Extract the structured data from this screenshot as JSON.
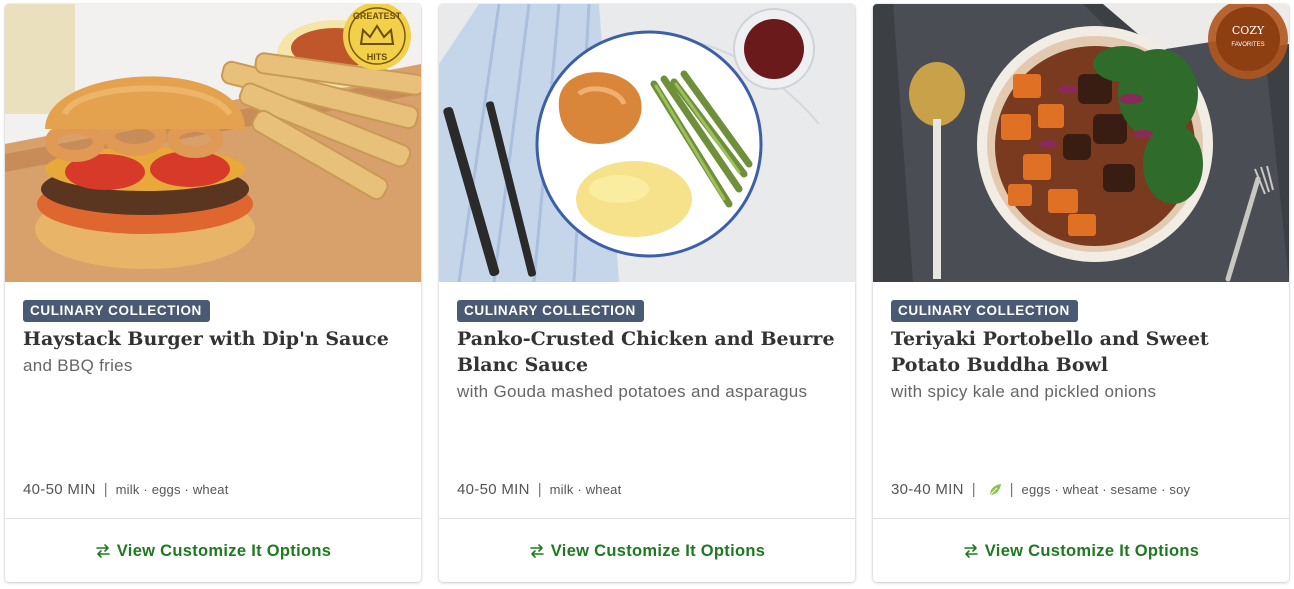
{
  "cards": [
    {
      "badge": "CULINARY COLLECTION",
      "title": "Haystack Burger with Dip'n Sauce",
      "subtitle": "and BBQ fries",
      "time": "40-50 MIN",
      "allergens": "milk · eggs · wheat",
      "seal_line1": "GREATEST",
      "seal_line2": "HITS",
      "customize_label": "View Customize It Options"
    },
    {
      "badge": "CULINARY COLLECTION",
      "title": "Panko-Crusted Chicken and Beurre Blanc Sauce",
      "subtitle": "with Gouda mashed potatoes and asparagus",
      "time": "40-50 MIN",
      "allergens": "milk · wheat",
      "customize_label": "View Customize It Options"
    },
    {
      "badge": "CULINARY COLLECTION",
      "title": "Teriyaki Portobello and Sweet Potato Buddha Bowl",
      "subtitle": "with spicy kale and pickled onions",
      "time": "30-40 MIN",
      "allergens": "eggs · wheat · sesame · soy",
      "seal_line1": "COZY",
      "seal_line2": "FAVORITES",
      "customize_label": "View Customize It Options"
    }
  ],
  "icons": {
    "customize": "swap-arrows-icon",
    "vegetarian": "leaf-icon"
  },
  "colors": {
    "badge_bg": "#4a5a72",
    "link_green": "#1f7a1f",
    "leaf_green": "#8bc34a"
  }
}
